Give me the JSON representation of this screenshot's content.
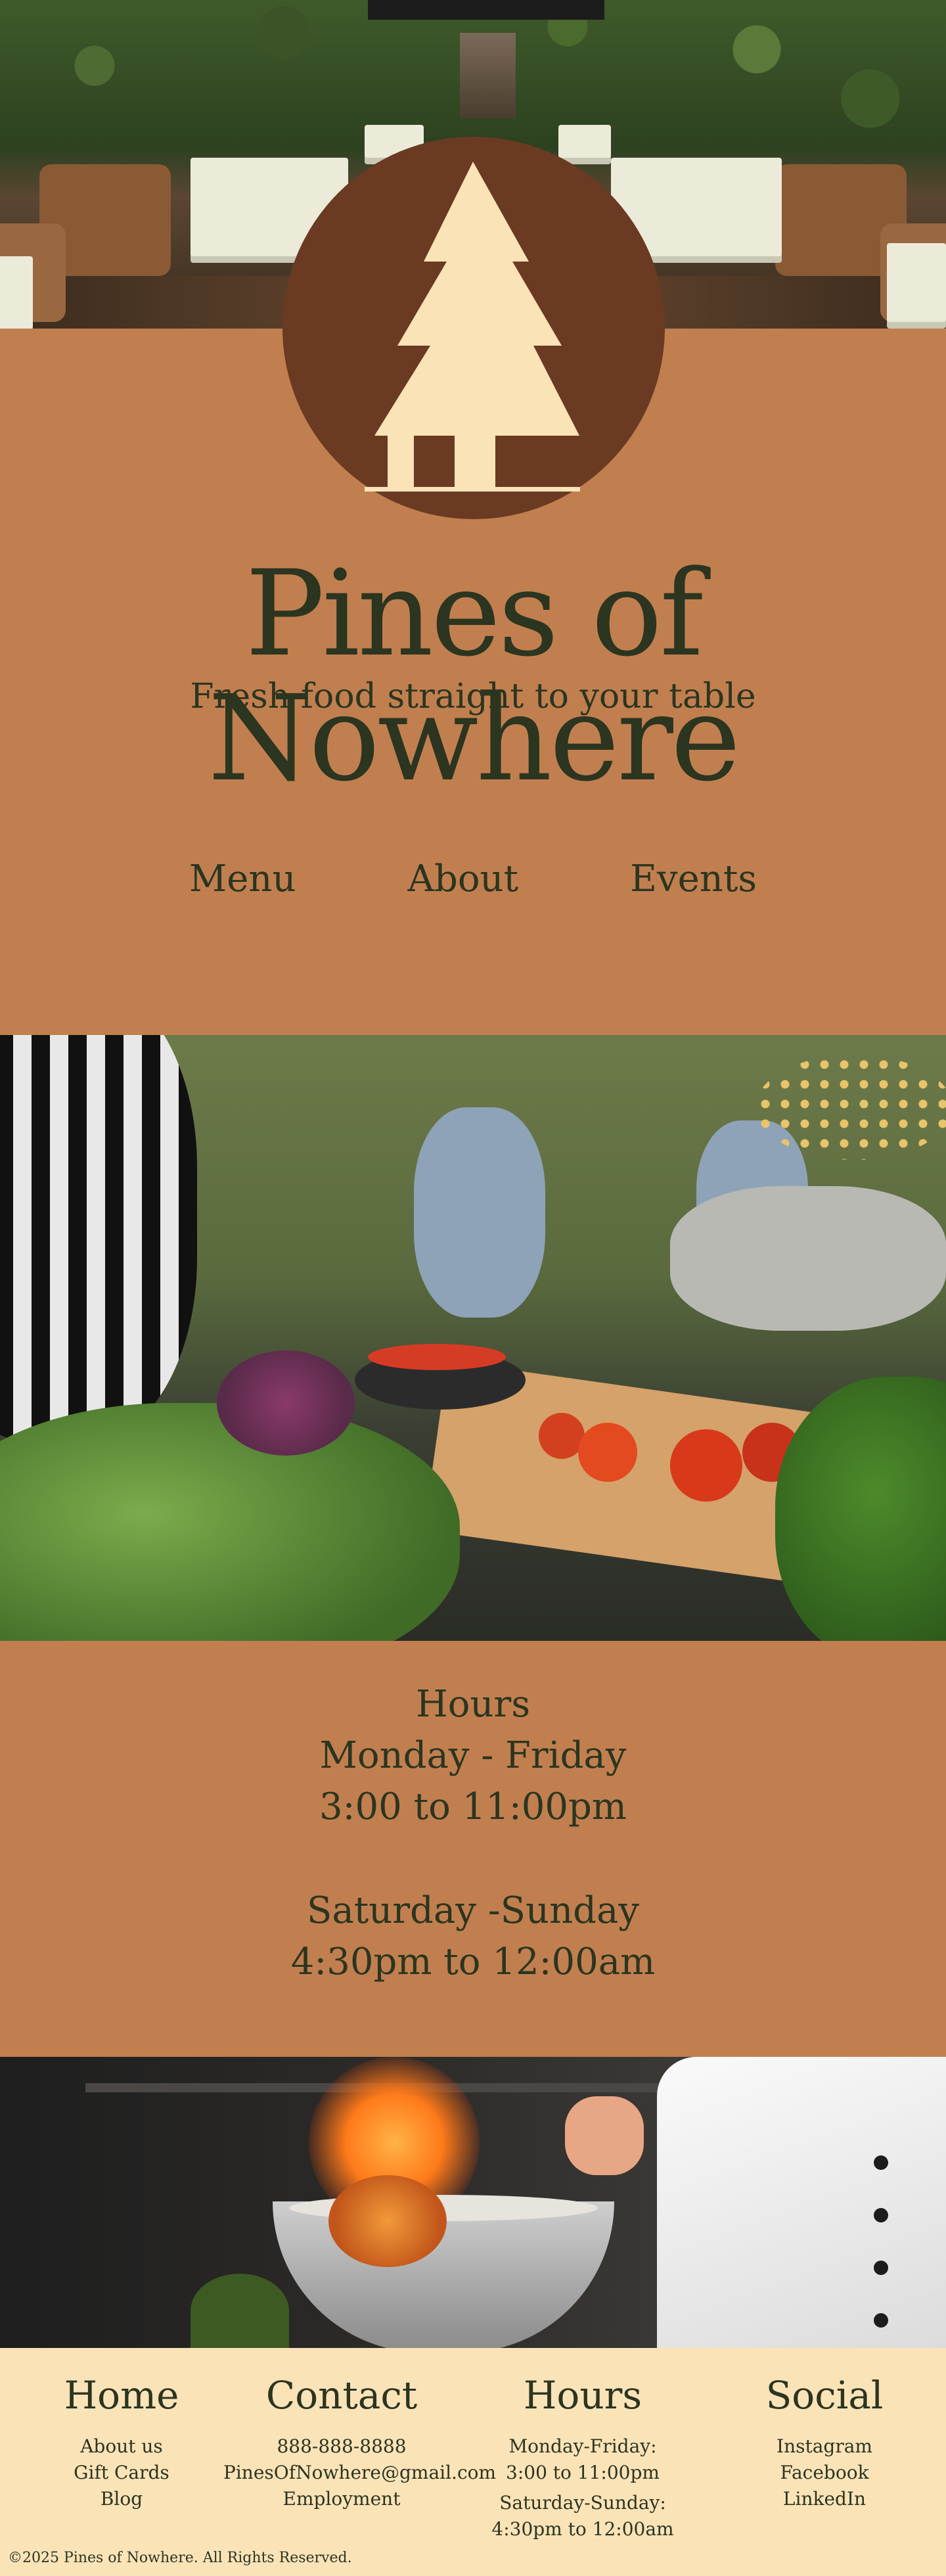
{
  "brand": {
    "name": "Pines of Nowhere",
    "tagline": "Fresh food straight to your table"
  },
  "nav": {
    "items": [
      "Menu",
      "About",
      "Events"
    ]
  },
  "hours": {
    "heading": "Hours",
    "weekday_label": "Monday - Friday",
    "weekday_time": "3:00 to 11:00pm",
    "weekend_label": "Saturday -Sunday",
    "weekend_time": "4:30pm to 12:00am"
  },
  "footer": {
    "home": {
      "heading": "Home",
      "links": [
        "About us",
        "Gift Cards",
        "Blog"
      ]
    },
    "contact": {
      "heading": "Contact",
      "phone": "888-888-8888",
      "email": "PinesOfNowhere@gmail.com",
      "employment": "Employment"
    },
    "hours": {
      "heading": "Hours",
      "weekday_label": "Monday-Friday:",
      "weekday_time": "3:00 to 11:00pm",
      "weekend_label": "Saturday-Sunday:",
      "weekend_time": "4:30pm to 12:00am"
    },
    "social": {
      "heading": "Social",
      "links": [
        "Instagram",
        "Facebook",
        "LinkedIn"
      ]
    },
    "copyright": "©2025 Pines of Nowhere. All Rights Reserved."
  },
  "colors": {
    "background": "#c17f4f",
    "logo_circle": "#6b3a22",
    "logo_tree": "#fbe3b8",
    "text": "#2b3520",
    "footer_bg": "#fbe3b8"
  },
  "icons": {
    "logo": "pine-tree-icon"
  }
}
